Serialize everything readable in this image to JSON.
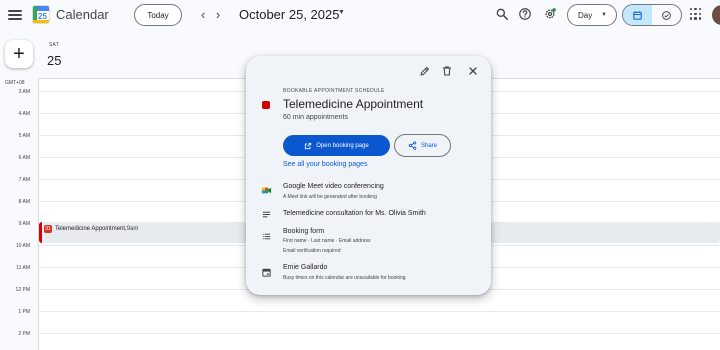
{
  "header": {
    "app_title": "Calendar",
    "logo_day": "25",
    "today_label": "Today",
    "prev_glyph": "‹",
    "next_glyph": "›",
    "date_title": "October 25, 2025",
    "view_label": "Day",
    "icons": [
      "menu-icon",
      "search-icon",
      "help-icon",
      "settings-icon",
      "calendar-view-icon",
      "tasks-view-icon",
      "apps-grid-icon"
    ]
  },
  "sidebar": {
    "create_label": "+"
  },
  "day_header": {
    "day_name": "SAT",
    "day_number": "25",
    "timezone": "GMT+08"
  },
  "hours": [
    "3 AM",
    "4 AM",
    "5 AM",
    "6 AM",
    "7 AM",
    "8 AM",
    "9 AM",
    "10 AM",
    "11 AM",
    "12 PM",
    "1 PM",
    "2 PM"
  ],
  "event": {
    "icon_label": "31",
    "title": "Telemedicine Appointment,",
    "time": " 9am",
    "color": "#d50000"
  },
  "popup": {
    "eyebrow": "BOOKABLE APPOINTMENT SCHEDULE",
    "title": "Telemedicine Appointment",
    "subtitle": "60 min appointments",
    "color": "#d50000",
    "open_label": "Open booking page",
    "share_label": "Share",
    "see_all_label": "See all your booking pages",
    "meet_title": "Google Meet video conferencing",
    "meet_sub": "A Meet link will be generated after booking",
    "description": "Telemedicine consultation for Ms. Olivia Smith",
    "form_title": "Booking form",
    "form_fields": "First name · Last name · Email address",
    "form_verification": "Email verification required",
    "owner_name": "Emie Gallardo",
    "owner_note": "Busy times on this calendar are unavailable for booking"
  }
}
